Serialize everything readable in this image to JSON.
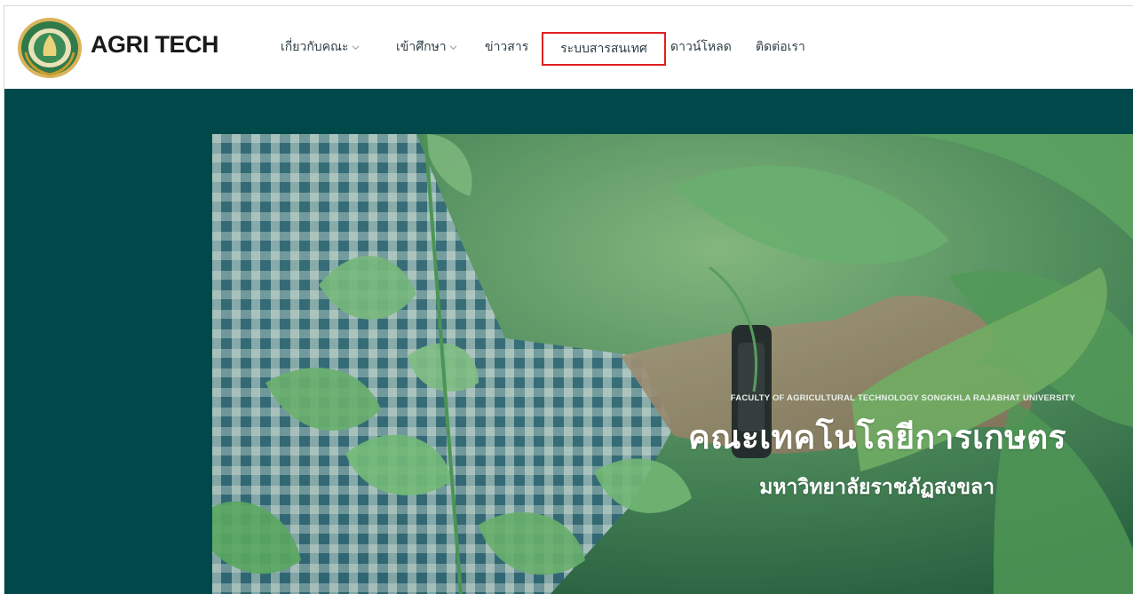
{
  "brand": {
    "name": "AGRI TECH",
    "seal": "faculty-seal-logo"
  },
  "nav": {
    "items": [
      {
        "label": "เกี่ยวกับคณะ",
        "dropdown": true
      },
      {
        "label": "เข้าศึกษา",
        "dropdown": true
      },
      {
        "label": "ข่าวสาร",
        "dropdown": false
      },
      {
        "label": "ระบบสารสนเทศ",
        "dropdown": false,
        "highlighted": true
      },
      {
        "label": "ดาวน์โหลด",
        "dropdown": false
      },
      {
        "label": "ติดต่อเรา",
        "dropdown": false
      }
    ]
  },
  "hero": {
    "subtitle": "FACULTY OF AGRICULTURAL TECHNOLOGY SONGKHLA RAJABHAT UNIVERSITY",
    "title": "คณะเทคโนโลยีการเกษตร",
    "university": "มหาวิทยาลัยราชภัฏสงขลา"
  },
  "colors": {
    "hero_band": "#01484a",
    "highlight_border": "#e02020",
    "nav_text": "#2f3e46"
  }
}
